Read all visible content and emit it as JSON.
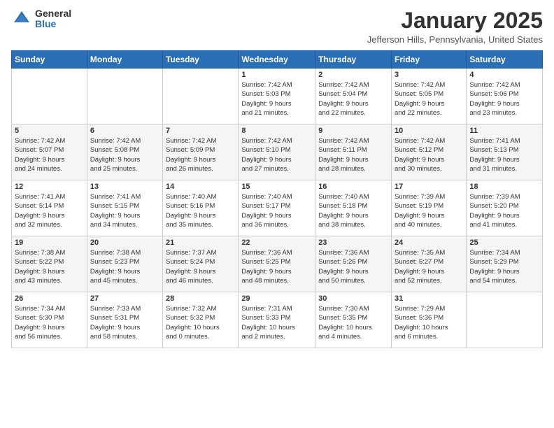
{
  "logo": {
    "general": "General",
    "blue": "Blue"
  },
  "title": "January 2025",
  "location": "Jefferson Hills, Pennsylvania, United States",
  "days_of_week": [
    "Sunday",
    "Monday",
    "Tuesday",
    "Wednesday",
    "Thursday",
    "Friday",
    "Saturday"
  ],
  "weeks": [
    [
      {
        "day": "",
        "info": ""
      },
      {
        "day": "",
        "info": ""
      },
      {
        "day": "",
        "info": ""
      },
      {
        "day": "1",
        "info": "Sunrise: 7:42 AM\nSunset: 5:03 PM\nDaylight: 9 hours\nand 21 minutes."
      },
      {
        "day": "2",
        "info": "Sunrise: 7:42 AM\nSunset: 5:04 PM\nDaylight: 9 hours\nand 22 minutes."
      },
      {
        "day": "3",
        "info": "Sunrise: 7:42 AM\nSunset: 5:05 PM\nDaylight: 9 hours\nand 22 minutes."
      },
      {
        "day": "4",
        "info": "Sunrise: 7:42 AM\nSunset: 5:06 PM\nDaylight: 9 hours\nand 23 minutes."
      }
    ],
    [
      {
        "day": "5",
        "info": "Sunrise: 7:42 AM\nSunset: 5:07 PM\nDaylight: 9 hours\nand 24 minutes."
      },
      {
        "day": "6",
        "info": "Sunrise: 7:42 AM\nSunset: 5:08 PM\nDaylight: 9 hours\nand 25 minutes."
      },
      {
        "day": "7",
        "info": "Sunrise: 7:42 AM\nSunset: 5:09 PM\nDaylight: 9 hours\nand 26 minutes."
      },
      {
        "day": "8",
        "info": "Sunrise: 7:42 AM\nSunset: 5:10 PM\nDaylight: 9 hours\nand 27 minutes."
      },
      {
        "day": "9",
        "info": "Sunrise: 7:42 AM\nSunset: 5:11 PM\nDaylight: 9 hours\nand 28 minutes."
      },
      {
        "day": "10",
        "info": "Sunrise: 7:42 AM\nSunset: 5:12 PM\nDaylight: 9 hours\nand 30 minutes."
      },
      {
        "day": "11",
        "info": "Sunrise: 7:41 AM\nSunset: 5:13 PM\nDaylight: 9 hours\nand 31 minutes."
      }
    ],
    [
      {
        "day": "12",
        "info": "Sunrise: 7:41 AM\nSunset: 5:14 PM\nDaylight: 9 hours\nand 32 minutes."
      },
      {
        "day": "13",
        "info": "Sunrise: 7:41 AM\nSunset: 5:15 PM\nDaylight: 9 hours\nand 34 minutes."
      },
      {
        "day": "14",
        "info": "Sunrise: 7:40 AM\nSunset: 5:16 PM\nDaylight: 9 hours\nand 35 minutes."
      },
      {
        "day": "15",
        "info": "Sunrise: 7:40 AM\nSunset: 5:17 PM\nDaylight: 9 hours\nand 36 minutes."
      },
      {
        "day": "16",
        "info": "Sunrise: 7:40 AM\nSunset: 5:18 PM\nDaylight: 9 hours\nand 38 minutes."
      },
      {
        "day": "17",
        "info": "Sunrise: 7:39 AM\nSunset: 5:19 PM\nDaylight: 9 hours\nand 40 minutes."
      },
      {
        "day": "18",
        "info": "Sunrise: 7:39 AM\nSunset: 5:20 PM\nDaylight: 9 hours\nand 41 minutes."
      }
    ],
    [
      {
        "day": "19",
        "info": "Sunrise: 7:38 AM\nSunset: 5:22 PM\nDaylight: 9 hours\nand 43 minutes."
      },
      {
        "day": "20",
        "info": "Sunrise: 7:38 AM\nSunset: 5:23 PM\nDaylight: 9 hours\nand 45 minutes."
      },
      {
        "day": "21",
        "info": "Sunrise: 7:37 AM\nSunset: 5:24 PM\nDaylight: 9 hours\nand 46 minutes."
      },
      {
        "day": "22",
        "info": "Sunrise: 7:36 AM\nSunset: 5:25 PM\nDaylight: 9 hours\nand 48 minutes."
      },
      {
        "day": "23",
        "info": "Sunrise: 7:36 AM\nSunset: 5:26 PM\nDaylight: 9 hours\nand 50 minutes."
      },
      {
        "day": "24",
        "info": "Sunrise: 7:35 AM\nSunset: 5:27 PM\nDaylight: 9 hours\nand 52 minutes."
      },
      {
        "day": "25",
        "info": "Sunrise: 7:34 AM\nSunset: 5:29 PM\nDaylight: 9 hours\nand 54 minutes."
      }
    ],
    [
      {
        "day": "26",
        "info": "Sunrise: 7:34 AM\nSunset: 5:30 PM\nDaylight: 9 hours\nand 56 minutes."
      },
      {
        "day": "27",
        "info": "Sunrise: 7:33 AM\nSunset: 5:31 PM\nDaylight: 9 hours\nand 58 minutes."
      },
      {
        "day": "28",
        "info": "Sunrise: 7:32 AM\nSunset: 5:32 PM\nDaylight: 10 hours\nand 0 minutes."
      },
      {
        "day": "29",
        "info": "Sunrise: 7:31 AM\nSunset: 5:33 PM\nDaylight: 10 hours\nand 2 minutes."
      },
      {
        "day": "30",
        "info": "Sunrise: 7:30 AM\nSunset: 5:35 PM\nDaylight: 10 hours\nand 4 minutes."
      },
      {
        "day": "31",
        "info": "Sunrise: 7:29 AM\nSunset: 5:36 PM\nDaylight: 10 hours\nand 6 minutes."
      },
      {
        "day": "",
        "info": ""
      }
    ]
  ]
}
